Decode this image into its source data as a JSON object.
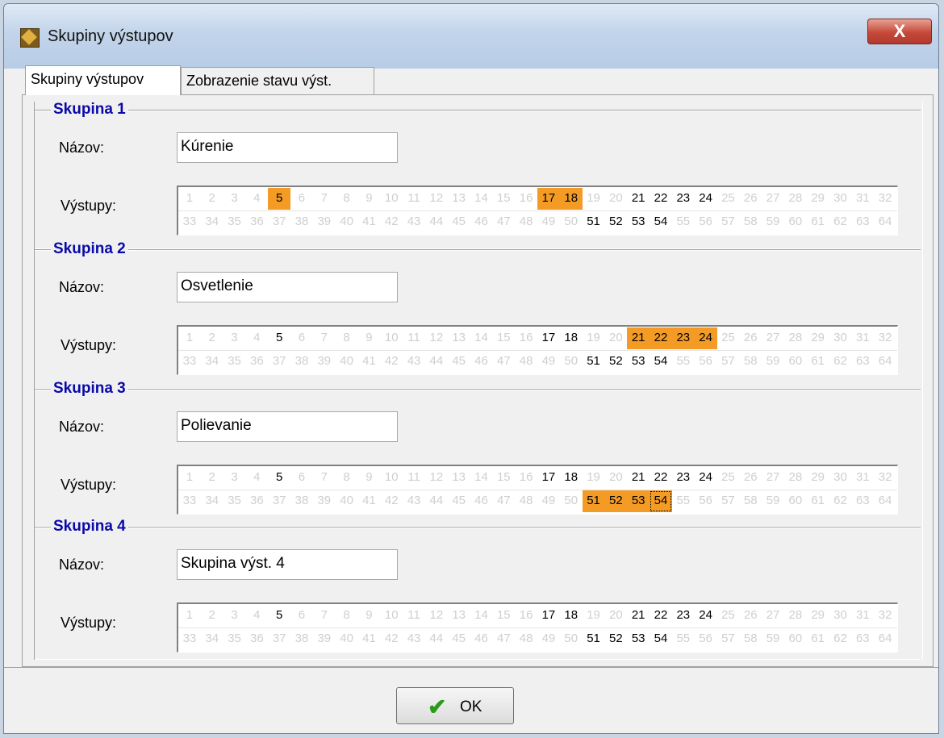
{
  "window": {
    "title": "Skupiny výstupov",
    "close_label": "X"
  },
  "tabs": [
    {
      "label": "Skupiny výstupov"
    },
    {
      "label": "Zobrazenie stavu výst."
    }
  ],
  "labels": {
    "name": "Názov:",
    "outputs": "Výstupy:"
  },
  "colors": {
    "selected": "#f39b25",
    "group_title": "#0a0aa8"
  },
  "active_outputs": [
    5,
    17,
    18,
    21,
    22,
    23,
    24,
    51,
    52,
    53,
    54
  ],
  "groups": [
    {
      "title": "Skupina 1",
      "name": "Kúrenie",
      "selected": [
        5,
        17,
        18
      ]
    },
    {
      "title": "Skupina 2",
      "name": "Osvetlenie",
      "selected": [
        21,
        22,
        23,
        24
      ]
    },
    {
      "title": "Skupina 3",
      "name": "Polievanie",
      "selected": [
        51,
        52,
        53,
        54
      ],
      "focused": 54
    },
    {
      "title": "Skupina 4",
      "name": "Skupina výst. 4",
      "selected": []
    }
  ],
  "footer": {
    "ok_label": "OK",
    "ok_icon": "checkmark-icon"
  }
}
